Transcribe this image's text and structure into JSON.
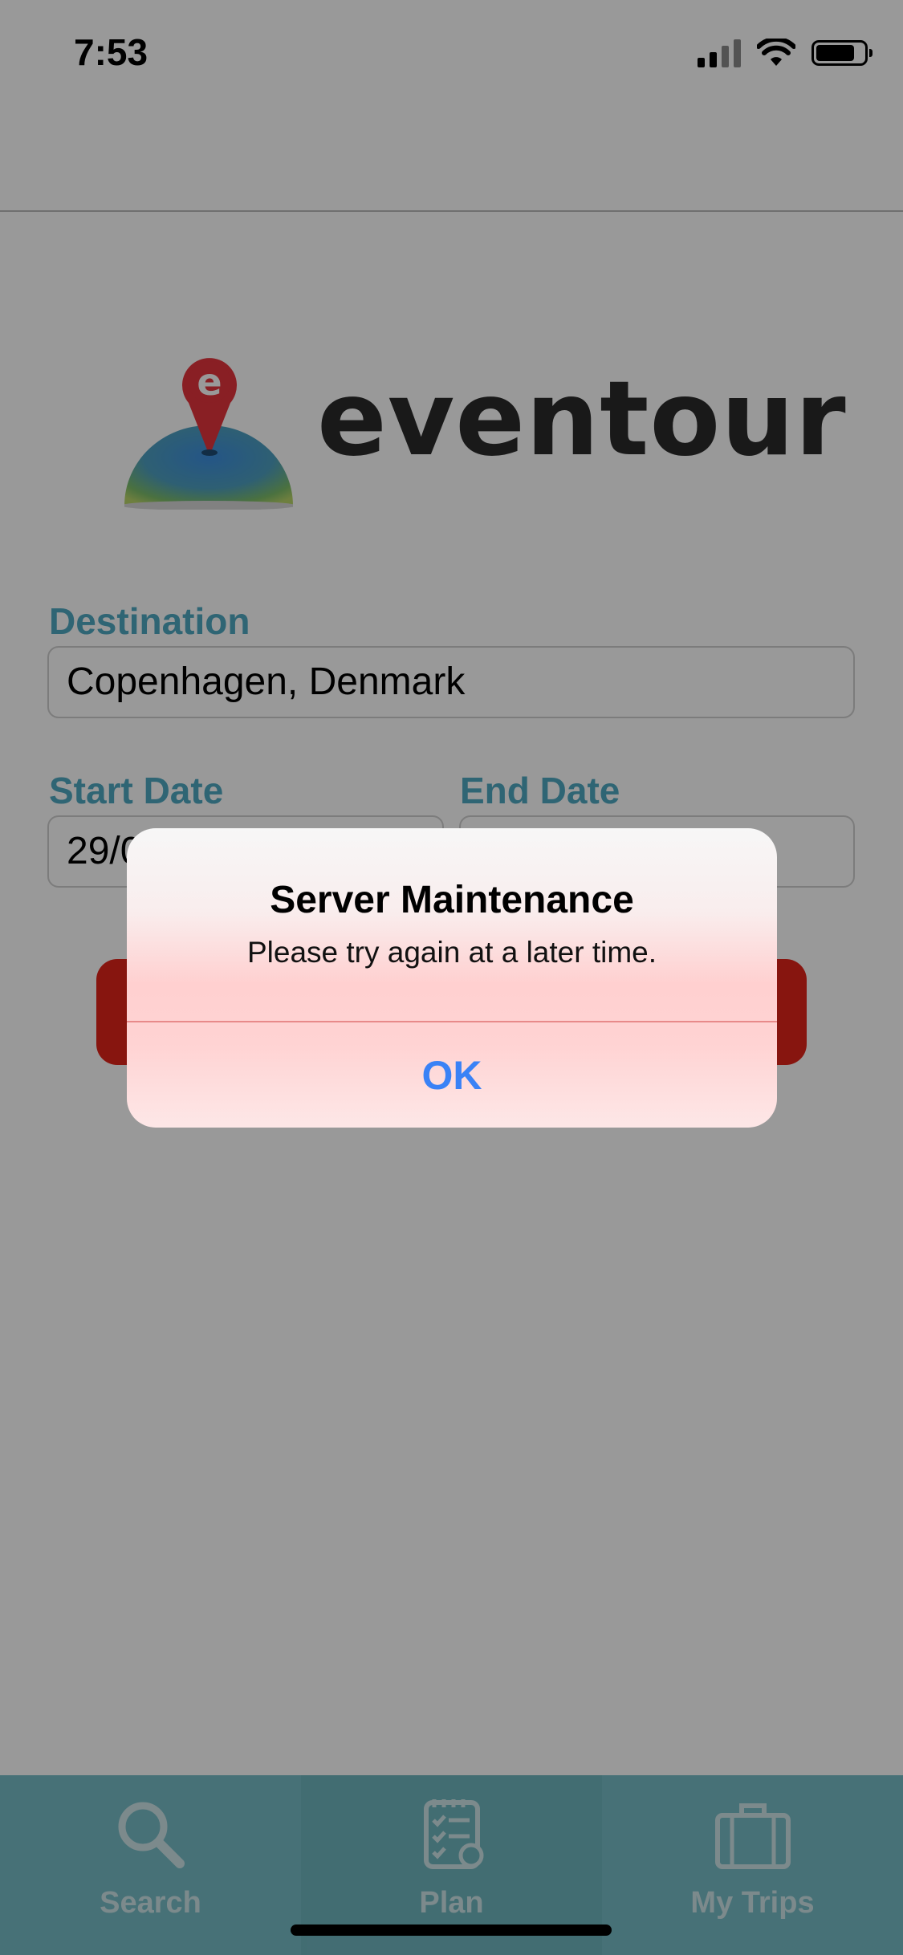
{
  "status_bar": {
    "time": "7:53",
    "icons": [
      "cellular-signal-icon",
      "wifi-icon",
      "battery-icon"
    ]
  },
  "logo": {
    "wordmark": "eventour",
    "pin_letter": "e"
  },
  "form": {
    "destination_label": "Destination",
    "destination_value": "Copenhagen, Denmark",
    "start_date_label": "Start Date",
    "start_date_value": "29/0",
    "end_date_label": "End Date",
    "end_date_value": ""
  },
  "tab_bar": {
    "tabs": [
      {
        "label": "Search",
        "icon": "search-icon",
        "active": false
      },
      {
        "label": "Plan",
        "icon": "checklist-icon",
        "active": true
      },
      {
        "label": "My Trips",
        "icon": "suitcase-icon",
        "active": false
      }
    ]
  },
  "alert": {
    "title": "Server Maintenance",
    "message": "Please try again at a later time.",
    "ok_label": "OK"
  },
  "colors": {
    "accent_teal": "#4fa9c1",
    "button_red": "#e2231a",
    "tab_bar_bg": "#77bcc6",
    "alert_link_blue": "#3a82f6"
  }
}
